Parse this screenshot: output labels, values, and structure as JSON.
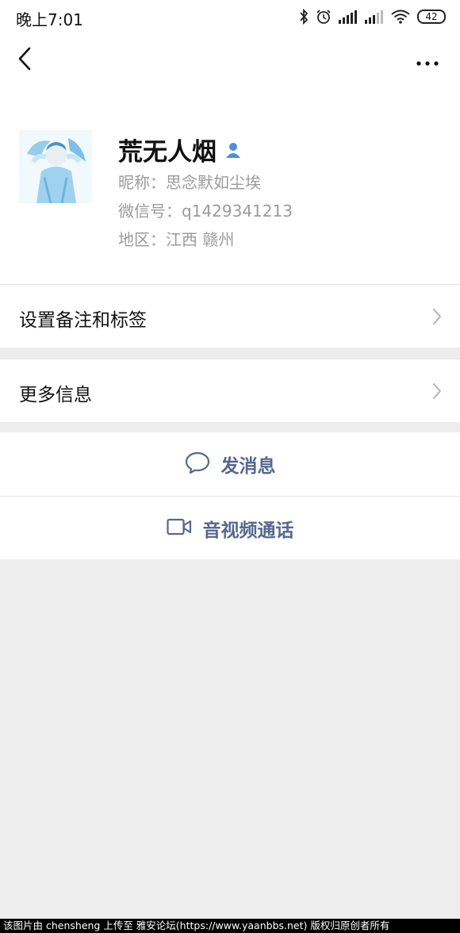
{
  "status_bar": {
    "time": "晚上7:01",
    "battery": "42",
    "icons": [
      "bluetooth-icon",
      "alarm-icon",
      "signal-icon",
      "signal-icon",
      "wifi-icon",
      "battery-icon"
    ]
  },
  "nav": {
    "back_icon": "chevron-left-icon",
    "more_icon": "more-dots-icon"
  },
  "profile": {
    "name": "荒无人烟",
    "nickname": "昵称：思念默如尘埃",
    "wechat_id": "微信号：q1429341213",
    "region": "地区：江西  赣州",
    "badge_icon": "person-icon"
  },
  "rows": {
    "notes_label": "设置备注和标签",
    "more_info_label": "更多信息"
  },
  "actions": {
    "message_label": "发消息",
    "call_label": "音视频通话"
  },
  "watermark": "该图片由 chensheng 上传至 雅安论坛(https://www.yaanbbs.net) 版权归原创者所有",
  "colors": {
    "accent_text": "#56678f",
    "background": "#ededed",
    "secondary_text": "#9b9b9b"
  }
}
